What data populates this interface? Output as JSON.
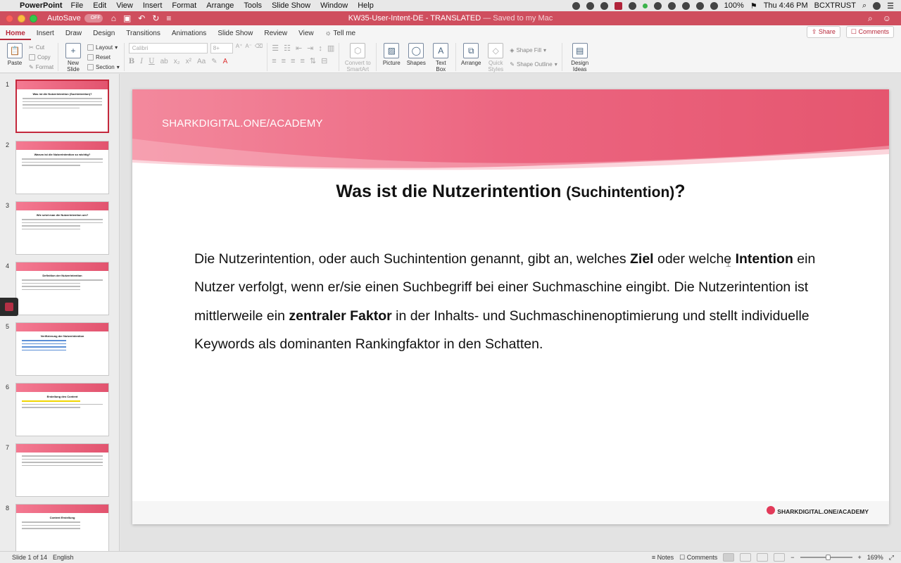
{
  "menubar": {
    "app_name": "PowerPoint",
    "menus": [
      "File",
      "Edit",
      "View",
      "Insert",
      "Format",
      "Arrange",
      "Tools",
      "Slide Show",
      "Window",
      "Help"
    ],
    "battery": "100%",
    "clock": "Thu 4:46 PM",
    "user": "BCXTRUST"
  },
  "titlebar": {
    "autosave_label": "AutoSave",
    "autosave_state": "OFF",
    "doc_name": "KW35-User-Intent-DE - TRANSLATED",
    "saved_status": "— Saved to my Mac"
  },
  "ribbon": {
    "tabs": [
      "Home",
      "Insert",
      "Draw",
      "Design",
      "Transitions",
      "Animations",
      "Slide Show",
      "Review",
      "View"
    ],
    "active_tab": "Home",
    "tell_me": "Tell me",
    "share": "Share",
    "comments": "Comments",
    "paste": "Paste",
    "cut": "Cut",
    "copy": "Copy",
    "format": "Format",
    "new_slide": "New Slide",
    "layout": "Layout",
    "reset": "Reset",
    "section": "Section",
    "font_name": "Calibri",
    "font_size": "8+",
    "convert_smartart": "Convert to SmartArt",
    "picture": "Picture",
    "shapes": "Shapes",
    "text_box": "Text Box",
    "arrange": "Arrange",
    "quick_styles": "Quick Styles",
    "shape_fill": "Shape Fill",
    "shape_outline": "Shape Outline",
    "design_ideas": "Design Ideas"
  },
  "thumbnails": [
    {
      "num": "1",
      "title": "Was ist die Nutzerintention (Suchintention)?"
    },
    {
      "num": "2",
      "title": "Warum ist die Nutzerintention so wichtig?"
    },
    {
      "num": "3",
      "title": "Wie setzt man die Nutzerintention um?"
    },
    {
      "num": "4",
      "title": "Definition der Nutzerintention"
    },
    {
      "num": "5",
      "title": "Verifizierung der Nutzerintention"
    },
    {
      "num": "6",
      "title": "Erstellung des Content"
    },
    {
      "num": "7",
      "title": ""
    },
    {
      "num": "8",
      "title": "Content Erstellung"
    }
  ],
  "slide": {
    "banner_text": "SHARKDIGITAL.ONE/ACADEMY",
    "title_main": "Was ist die Nutzerintention",
    "title_sub": "(Suchintention)",
    "title_end": "?",
    "body": {
      "p1": "Die Nutzerintention, oder auch Suchintention genannt, gibt an, welches ",
      "b1": "Ziel",
      "p2": " oder welche ",
      "b2": "Intention",
      "p3": " ein Nutzer verfolgt, wenn er/sie einen Suchbegriff bei einer Suchmaschine eingibt. Die Nutzerintention ist mittlerweile ein ",
      "b3": "zentraler Faktor",
      "p4": " in der Inhalts- und Suchmaschinenoptimierung und stellt individuelle Keywords als dominanten Rankingfaktor in den Schatten."
    },
    "footer_logo": "SHARKDIGITAL.ONE/ACADEMY"
  },
  "statusbar": {
    "slide_info": "Slide 1 of 14",
    "language": "English",
    "notes": "Notes",
    "comments": "Comments",
    "zoom": "169%"
  },
  "colors": {
    "brand_red": "#cf4e5e",
    "banner_pink": "#ea5a74",
    "accent": "#b7283a"
  }
}
